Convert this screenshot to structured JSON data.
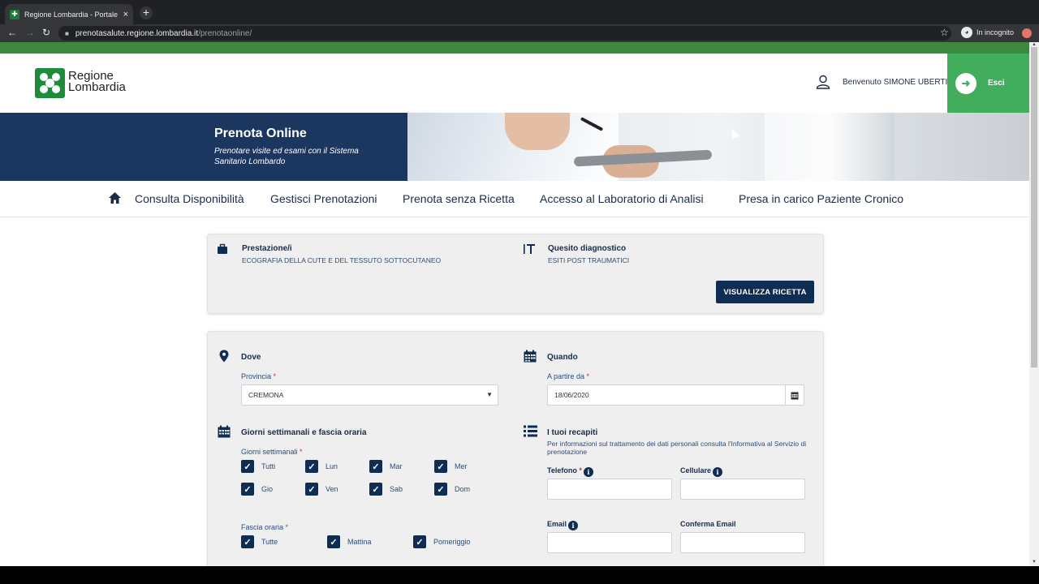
{
  "browser": {
    "tab_title": "Regione Lombardia - Portale Prenota Online",
    "tab_close": "×",
    "new_tab": "+",
    "url_host": "prenotasalute.regione.lombardia.it",
    "url_path": "/prenotaonline/",
    "incognito_label": "In incognito"
  },
  "header": {
    "logo_line1": "Regione",
    "logo_line2": "Lombardia",
    "welcome": "Benvenuto SIMONE UBERTI",
    "logout_label": "Esci"
  },
  "banner": {
    "title": "Prenota Online",
    "subtitle": "Prenotare visite ed esami con il Sistema Sanitario Lombardo"
  },
  "nav": {
    "items": [
      {
        "label": "Consulta Disponibilità"
      },
      {
        "label": "Gestisci Prenotazioni"
      },
      {
        "label": "Prenota senza Ricetta"
      },
      {
        "label": "Accesso al Laboratorio di Analisi"
      },
      {
        "label": "Presa in carico Paziente Cronico"
      }
    ]
  },
  "prescription": {
    "prestazione_title": "Prestazione/i",
    "prestazione_value": "ECOGRAFIA DELLA CUTE E DEL TESSUTO SOTTOCUTANEO",
    "quesito_title": "Quesito diagnostico",
    "quesito_value": "ESITI POST TRAUMATICI",
    "view_button": "VISUALIZZA RICETTA"
  },
  "form": {
    "dove_title": "Dove",
    "provincia_label": "Provincia",
    "provincia_value": "CREMONA",
    "quando_title": "Quando",
    "a_partire_label": "A partire da",
    "a_partire_value": "18/06/2020",
    "giorni_title": "Giorni settimanali e fascia oraria",
    "giorni_label": "Giorni settimanali",
    "days": [
      {
        "label": "Tutti",
        "checked": true
      },
      {
        "label": "Lun",
        "checked": true
      },
      {
        "label": "Mar",
        "checked": true
      },
      {
        "label": "Mer",
        "checked": true
      },
      {
        "label": "Gio",
        "checked": true
      },
      {
        "label": "Ven",
        "checked": true
      },
      {
        "label": "Sab",
        "checked": true
      },
      {
        "label": "Dom",
        "checked": true
      }
    ],
    "fascia_label": "Fascia oraria",
    "fascia": [
      {
        "label": "Tutte",
        "checked": true
      },
      {
        "label": "Mattina",
        "checked": true
      },
      {
        "label": "Pomeriggio",
        "checked": true
      }
    ],
    "recapiti_title": "I tuoi recapiti",
    "privacy_text": "Per informazioni sul trattamento dei dati personali consulta l'Informativa al Servizio di prenotazione",
    "telefono_label": "Telefono",
    "cellulare_label": "Cellulare",
    "email_label": "Email",
    "conferma_email_label": "Conferma Email",
    "required_mark": "*",
    "info_glyph": "i"
  },
  "colors": {
    "brand_green": "#3d8a3f",
    "banner_navy": "#1b365f",
    "button_navy": "#0f2d52",
    "logout_green": "#43ad5e"
  }
}
